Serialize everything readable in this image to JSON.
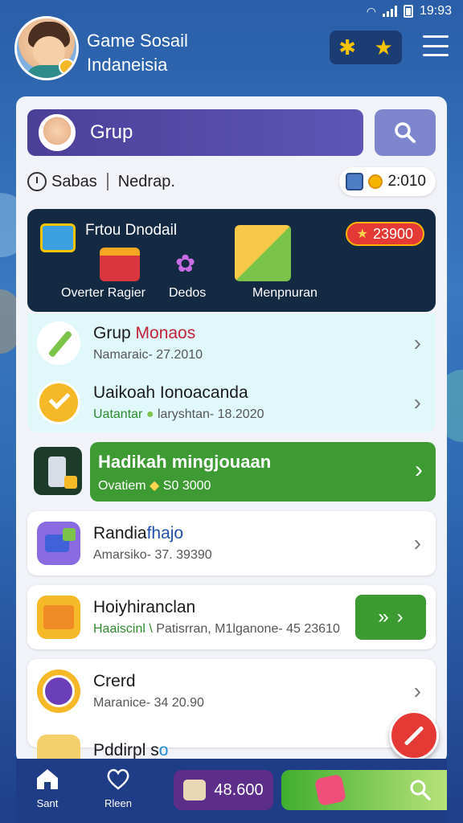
{
  "status_bar": {
    "time": "19:93"
  },
  "header": {
    "title_line1": "Game Sosail",
    "title_line2": "Indaneisia",
    "action_icon_1": "sparkle-icon",
    "action_icon_2": "star-icon"
  },
  "search_bar": {
    "group_label": "Grup"
  },
  "filters": {
    "left_label": "Sabas",
    "right_label": "Nedrap.",
    "coins": "2:010"
  },
  "rewards_banner": {
    "title": "Frtou Dnodail",
    "badge_value": "23900",
    "labels": [
      "Overter Ragier",
      "Dedos",
      "Menpnuran"
    ]
  },
  "list_items": [
    {
      "title": "Grup ",
      "title_accent": "Monaos",
      "subtitle": "Namaraic- 27.2010"
    },
    {
      "title": "Uaikoah Ionoacanda",
      "subtitle_accent": "Uatantar",
      "subtitle": "laryshtan- 18.2020"
    }
  ],
  "featured": {
    "title": "Hadikah mingjouaan",
    "subtitle_prefix": "Ovatiem",
    "subtitle_value": "S0 3000"
  },
  "cards": [
    {
      "title_a": "Randia",
      "title_b": "fhajo",
      "subtitle": "Amarsiko- 37. 39390"
    },
    {
      "title": "Hoiyhiranclan",
      "subtitle_accent": "Haaiscinl \\",
      "subtitle": "Patisrran, M1lganone- 45 23610"
    },
    {
      "title": "Crerd",
      "subtitle": "Maranice- 34 20.90"
    },
    {
      "title_a": "Pddirpl s",
      "title_b": "o"
    }
  ],
  "bottom_nav": {
    "home_label": "Sant",
    "favorite_label": "Rleen",
    "coins": "48.600"
  },
  "colors": {
    "accent_green": "#3e9b34",
    "accent_red": "#e53935",
    "header_blue": "#2a5ea8",
    "group_purple": "#4b3f98"
  }
}
